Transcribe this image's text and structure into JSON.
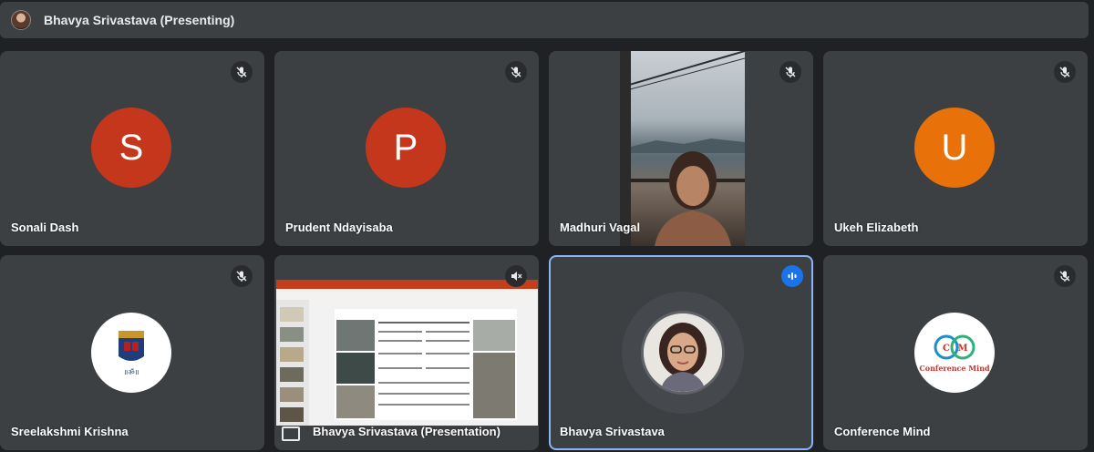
{
  "header": {
    "presenter_label": "Bhavya Srivastava (Presenting)"
  },
  "colors": {
    "background": "#202124",
    "tile": "#3c4043",
    "avatar_s": "#c5371c",
    "avatar_p": "#c5371c",
    "avatar_u": "#e8710a",
    "active_border": "#8ab4f8",
    "speaking": "#1a73e8"
  },
  "tiles": [
    {
      "name": "Sonali Dash",
      "avatar_letter": "S",
      "mic": "mic-off-icon"
    },
    {
      "name": "Prudent Ndayisaba",
      "avatar_letter": "P",
      "mic": "mic-off-icon"
    },
    {
      "name": "Madhuri Vagal",
      "mic": "mic-off-icon"
    },
    {
      "name": "Ukeh Elizabeth",
      "avatar_letter": "U",
      "mic": "mic-off-icon"
    },
    {
      "name": "Sreelakshmi Krishna",
      "mic": "mic-off-icon"
    },
    {
      "name": "Bhavya Srivastava (Presentation)",
      "mic": "volume-off-icon"
    },
    {
      "name": "Bhavya Srivastava",
      "mic": "speaking-icon"
    },
    {
      "name": "Conference Mind",
      "mic": "mic-off-icon",
      "logo_text": "Conference Mind"
    }
  ]
}
